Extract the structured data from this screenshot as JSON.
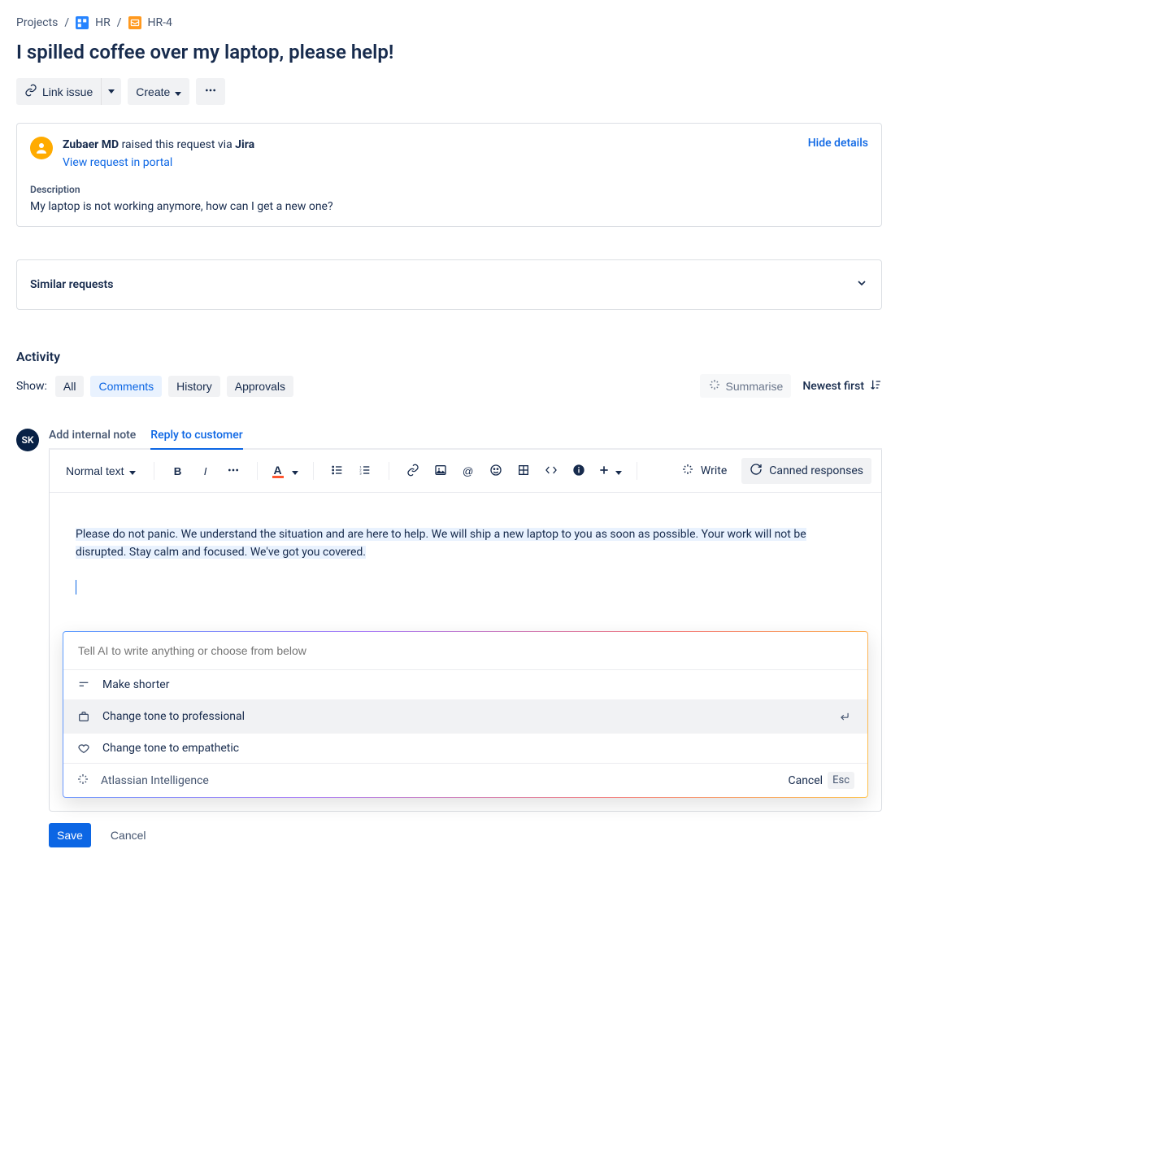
{
  "breadcrumb": {
    "projects": "Projects",
    "projectKey": "HR",
    "issueKey": "HR-4"
  },
  "page": {
    "title": "I spilled coffee over my laptop, please help!"
  },
  "actions": {
    "linkIssue": "Link issue",
    "create": "Create"
  },
  "requester": {
    "name": "Zubaer MD",
    "raisedVia": " raised this request via ",
    "source": "Jira",
    "viewPortal": "View request in portal",
    "hideDetails": "Hide details"
  },
  "description": {
    "label": "Description",
    "body": "My laptop is not working anymore, how can I get a new one?"
  },
  "similar": {
    "label": "Similar requests"
  },
  "activity": {
    "heading": "Activity",
    "showLabel": "Show:",
    "tabs": {
      "all": "All",
      "comments": "Comments",
      "history": "History",
      "approvals": "Approvals"
    },
    "summarise": "Summarise",
    "newestFirst": "Newest first"
  },
  "editorTabs": {
    "internal": "Add internal note",
    "reply": "Reply to customer"
  },
  "currentUser": {
    "initials": "SK"
  },
  "toolbar": {
    "normalText": "Normal text",
    "write": "Write",
    "canned": "Canned responses"
  },
  "editor": {
    "selectedText": "Please do not panic. We understand the situation and are here to help. We will ship a new laptop to you as soon as possible. Your work will not be disrupted. Stay calm and focused. We've got you covered."
  },
  "aiPanel": {
    "placeholder": "Tell AI to write anything or choose from below",
    "options": {
      "shorter": "Make shorter",
      "professional": "Change tone to professional",
      "empathetic": "Change tone to empathetic"
    },
    "brand": "Atlassian Intelligence",
    "cancel": "Cancel",
    "esc": "Esc"
  },
  "footer": {
    "save": "Save",
    "cancel": "Cancel"
  }
}
